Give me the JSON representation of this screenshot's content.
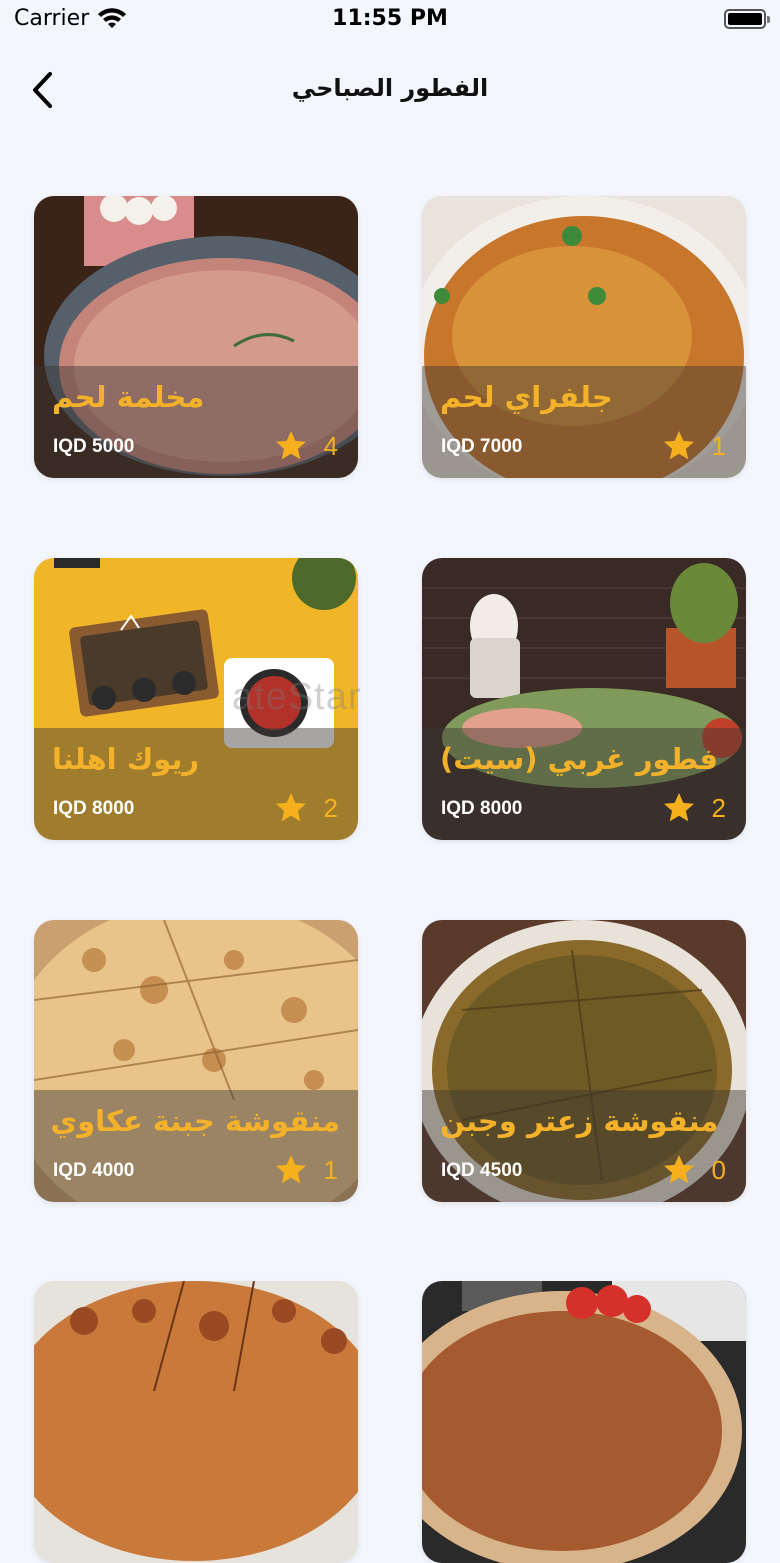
{
  "status": {
    "carrier": "Carrier",
    "time": "11:55 PM"
  },
  "nav": {
    "title": "الفطور الصباحي",
    "back_icon": "chevron-left-icon"
  },
  "watermark": "ateStar",
  "colors": {
    "accent": "#f4b22a",
    "star": "#f6b01e",
    "background": "#f3f6fc"
  },
  "items": [
    {
      "name": "مخلمة لحم",
      "price": "IQD 5000",
      "rating": "4"
    },
    {
      "name": "جلفراي لحم",
      "price": "IQD 7000",
      "rating": "1"
    },
    {
      "name": "ريوك اهلنا",
      "price": "IQD 8000",
      "rating": "2"
    },
    {
      "name": "فطور غربي (سيت)",
      "price": "IQD 8000",
      "rating": "2"
    },
    {
      "name": "منقوشة جبنة عكاوي",
      "price": "IQD 4000",
      "rating": "1"
    },
    {
      "name": "منقوشة زعتر وجبن",
      "price": "IQD 4500",
      "rating": "0"
    },
    {
      "name": "",
      "price": "",
      "rating": ""
    },
    {
      "name": "",
      "price": "",
      "rating": ""
    }
  ]
}
